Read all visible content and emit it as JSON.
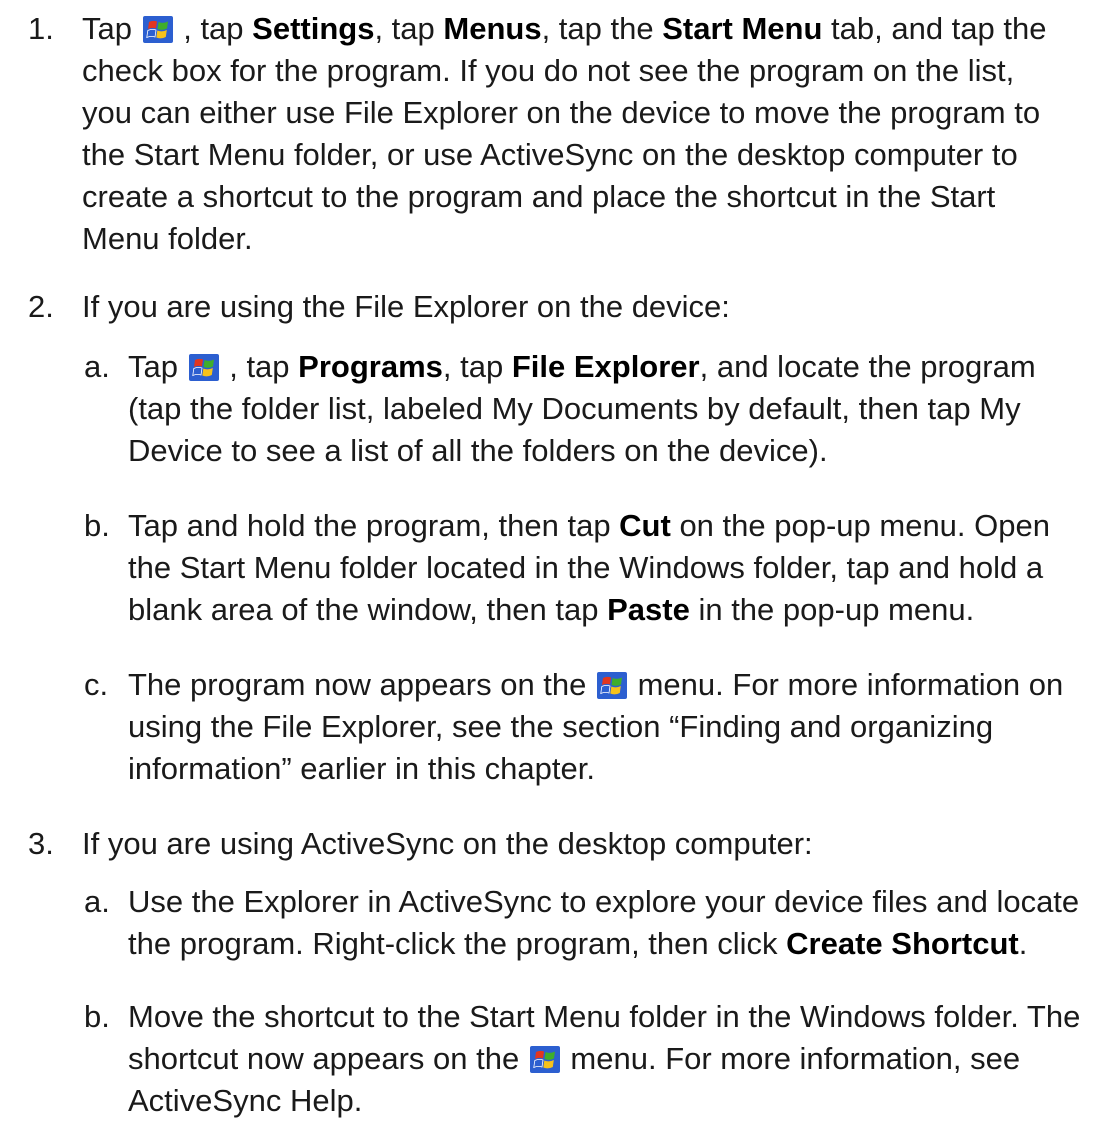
{
  "colors": {
    "text": "#1a1a1a",
    "start_icon_blue": "#2c5fd0",
    "start_icon_red": "#e2361f",
    "start_icon_green": "#3fae2b",
    "start_icon_yellow": "#f7c21b"
  },
  "icons": {
    "start_button": "windows-start-flag-icon"
  },
  "steps": [
    {
      "number": "1.",
      "line1": {
        "a": "Tap ",
        "b": " , tap ",
        "c": "Settings",
        "d": ", tap ",
        "e": "Menus",
        "f": ", tap the ",
        "g": "Start Menu",
        "h": " tab, and tap the"
      },
      "line2": "check box for the program. If you do not see the program on the list,",
      "line3": "you can either use File Explorer on the device to move the program to",
      "line4": "the Start Menu folder, or use ActiveSync on the desktop computer to",
      "line5": "create a shortcut to the program and place the shortcut in  the Start",
      "line6": "Menu folder."
    },
    {
      "number": "2.",
      "line1": "If you are using the File Explorer on the device:",
      "substeps": [
        {
          "letter": "a.",
          "line1": {
            "a": "Tap ",
            "b": " , tap ",
            "c": "Programs",
            "d": ", tap ",
            "e": "File Explorer",
            "f": ", and locate the program"
          },
          "line2": "(tap the folder list, labeled My Documents by default, then tap My",
          "line3": "Device to see a list of all the folders on the device)."
        },
        {
          "letter": "b.",
          "line1": {
            "a": "Tap and hold the program, then tap ",
            "b": "Cut",
            "c": " on the pop-up menu. Open"
          },
          "line2": "the Start Menu folder located in the Windows folder, tap and hold a",
          "line3": {
            "a": "blank area of the window, then tap ",
            "b": "Paste",
            "c": " in the pop-up menu."
          }
        },
        {
          "letter": "c.",
          "line1": {
            "a": "The program now appears on the ",
            "b": " menu. For more information on"
          },
          "line2": "using the File Explorer, see the section “Finding and organizing",
          "line3": "information” earlier in this chapter."
        }
      ]
    },
    {
      "number": "3.",
      "line1": "If you are using ActiveSync on the desktop computer:",
      "substeps": [
        {
          "letter": "a.",
          "line1": "Use the Explorer in ActiveSync to explore your device files and locate",
          "line2": {
            "a": "the program. Right-click the program, then click ",
            "b": "Create Shortcut",
            "c": "."
          }
        },
        {
          "letter": "b.",
          "line1": "Move the shortcut to the Start Menu folder in the Windows folder. The",
          "line2": {
            "a": "shortcut now appears on the ",
            "b": " menu. For more information, see"
          },
          "line3": "ActiveSync Help."
        }
      ]
    }
  ]
}
